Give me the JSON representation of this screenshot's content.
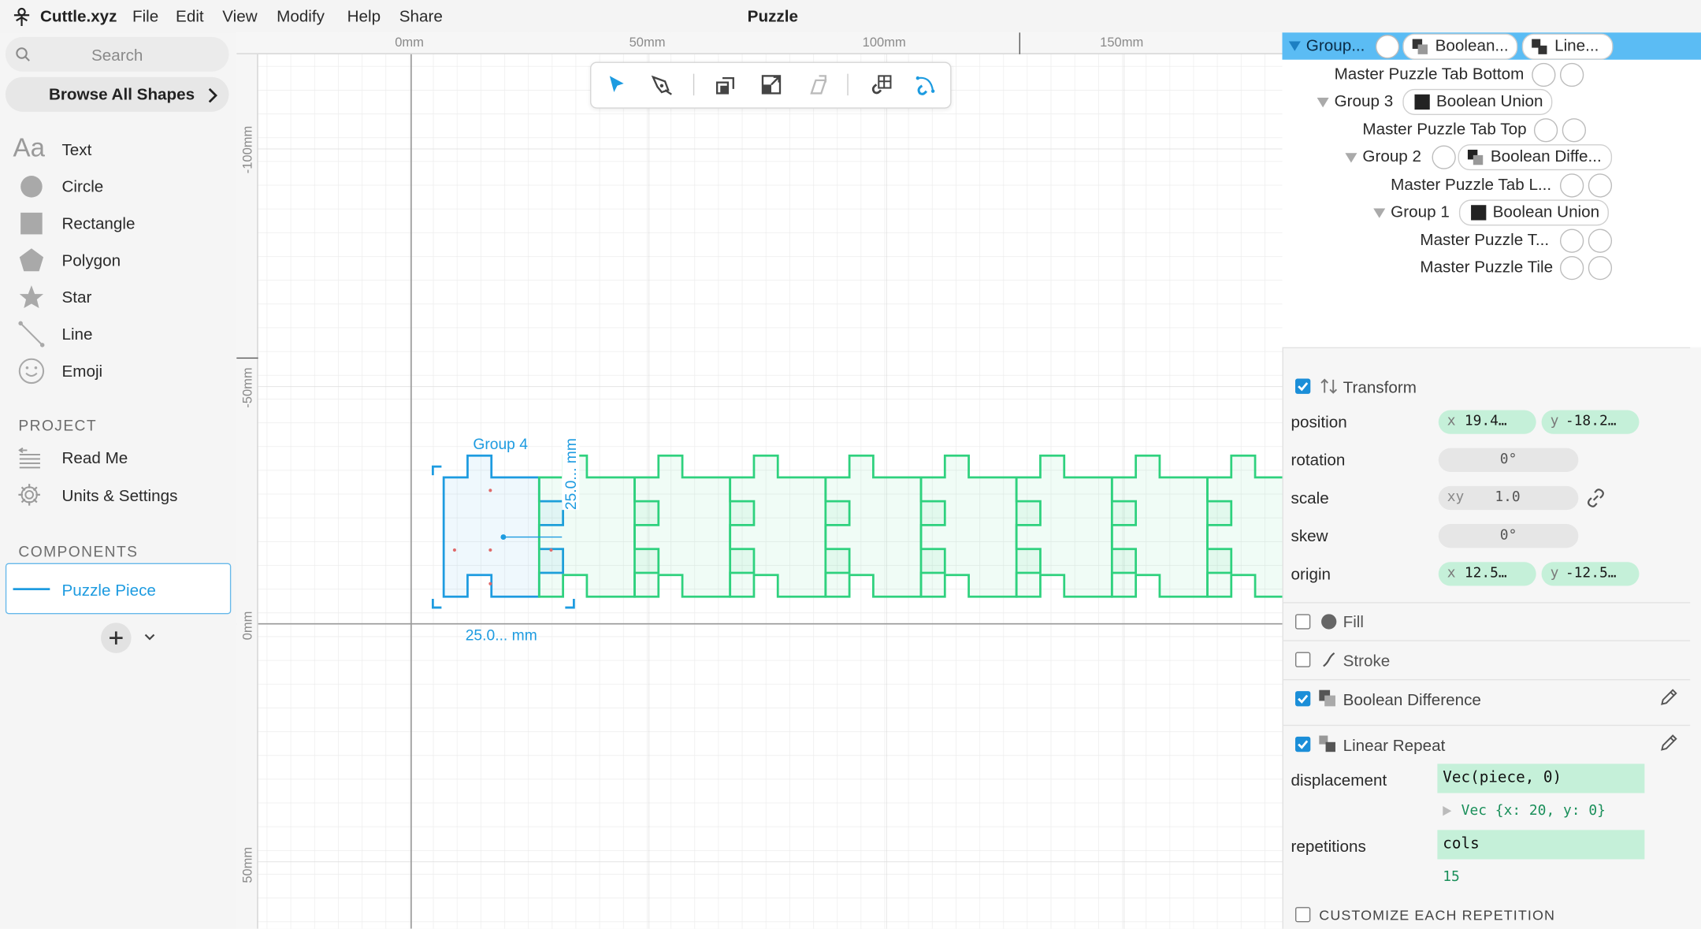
{
  "menubar": {
    "app_name": "Cuttle.xyz",
    "items": [
      "File",
      "Edit",
      "View",
      "Modify",
      "Help",
      "Share"
    ],
    "doc_title": "Puzzle"
  },
  "sidebar": {
    "search_placeholder": "Search",
    "browse_label": "Browse All Shapes",
    "shapes": [
      "Text",
      "Circle",
      "Rectangle",
      "Polygon",
      "Star",
      "Line",
      "Emoji"
    ],
    "project_header": "PROJECT",
    "project_items": [
      "Read Me",
      "Units & Settings"
    ],
    "components_header": "COMPONENTS",
    "component_name": "Puzzle Piece"
  },
  "rulers": {
    "top": [
      "0mm",
      "50mm",
      "100mm",
      "150mm"
    ],
    "left": [
      "-100mm",
      "-50mm",
      "0mm",
      "50mm"
    ]
  },
  "canvas": {
    "group_label": "Group 4",
    "width_label": "25.0... mm",
    "height_label": "25.0... mm",
    "accent": "#1d9be0",
    "repeat_color": "#2fd17e",
    "repeat_count": 15
  },
  "tree": [
    {
      "label": "Group...",
      "pills": [
        "Boolean...",
        "Line..."
      ],
      "selected": true
    },
    {
      "label": "Master Puzzle Tab Bottom"
    },
    {
      "label": "Group 3",
      "pills": [
        "Boolean Union"
      ]
    },
    {
      "label": "Master Puzzle Tab Top"
    },
    {
      "label": "Group 2",
      "pills": [
        "Boolean Diffe..."
      ]
    },
    {
      "label": "Master Puzzle Tab L..."
    },
    {
      "label": "Group 1",
      "pills": [
        "Boolean Union"
      ]
    },
    {
      "label": "Master Puzzle T..."
    },
    {
      "label": "Master Puzzle Tile"
    }
  ],
  "transform": {
    "title": "Transform",
    "position_label": "position",
    "position_x": "19.4…",
    "position_y": "-18.2…",
    "rotation_label": "rotation",
    "rotation": "0°",
    "scale_label": "scale",
    "scale_axis": "xy",
    "scale": "1.0",
    "skew_label": "skew",
    "skew": "0°",
    "origin_label": "origin",
    "origin_x": "12.5…",
    "origin_y": "-12.5…"
  },
  "fill_label": "Fill",
  "stroke_label": "Stroke",
  "boolean_label": "Boolean Difference",
  "linear_repeat": {
    "title": "Linear Repeat",
    "displacement_label": "displacement",
    "displacement": "Vec(piece, 0)",
    "displacement_result": "Vec {x: 20, y: 0}",
    "repetitions_label": "repetitions",
    "repetitions": "cols",
    "repetitions_result": "15",
    "customize_label": "CUSTOMIZE EACH REPETITION"
  }
}
